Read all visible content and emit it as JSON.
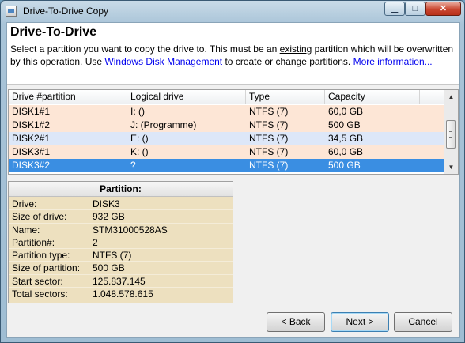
{
  "window": {
    "title": "Drive-To-Drive Copy",
    "controls": {
      "minimize": "▁",
      "maximize": "□",
      "close": "✕"
    }
  },
  "header": {
    "heading": "Drive-To-Drive",
    "desc_part1": "Select a partition you want to copy the drive to. This must be an ",
    "desc_emph": "existing",
    "desc_part2": " partition which will be overwritten by this operation. Use ",
    "link_disk_mgmt": "Windows Disk Management",
    "desc_part3": " to create or change partitions. ",
    "link_more": "More information..."
  },
  "table": {
    "columns": [
      "Drive #partition",
      "Logical drive",
      "Type",
      "Capacity"
    ],
    "rows": [
      {
        "drive": "DISK1#1",
        "logical": "I: ()",
        "type": "NTFS (7)",
        "capacity": "60,0 GB",
        "style": "peach"
      },
      {
        "drive": "DISK1#2",
        "logical": "J: (Programme)",
        "type": "NTFS (7)",
        "capacity": "500 GB",
        "style": "peach"
      },
      {
        "drive": "DISK2#1",
        "logical": "E: ()",
        "type": "NTFS (7)",
        "capacity": "34,5 GB",
        "style": "blue"
      },
      {
        "drive": "DISK3#1",
        "logical": "K: ()",
        "type": "NTFS (7)",
        "capacity": "60,0 GB",
        "style": "peach"
      },
      {
        "drive": "DISK3#2",
        "logical": "?",
        "type": "NTFS (7)",
        "capacity": "500 GB",
        "style": "sel"
      }
    ]
  },
  "partition": {
    "title": "Partition:",
    "fields": [
      {
        "label": "Drive:",
        "value": "DISK3"
      },
      {
        "label": "Size of drive:",
        "value": "932 GB"
      },
      {
        "label": "Name:",
        "value": "STM31000528AS"
      },
      {
        "label": "Partition#:",
        "value": "2"
      },
      {
        "label": "Partition type:",
        "value": "NTFS (7)"
      },
      {
        "label": "Size of partition:",
        "value": "500 GB"
      },
      {
        "label": "Start sector:",
        "value": "125.837.145"
      },
      {
        "label": "Total sectors:",
        "value": "1.048.578.615"
      }
    ]
  },
  "buttons": {
    "back_prefix": "< ",
    "back_accel": "B",
    "back_rest": "ack",
    "next_accel": "N",
    "next_rest": "ext >",
    "cancel": "Cancel"
  }
}
